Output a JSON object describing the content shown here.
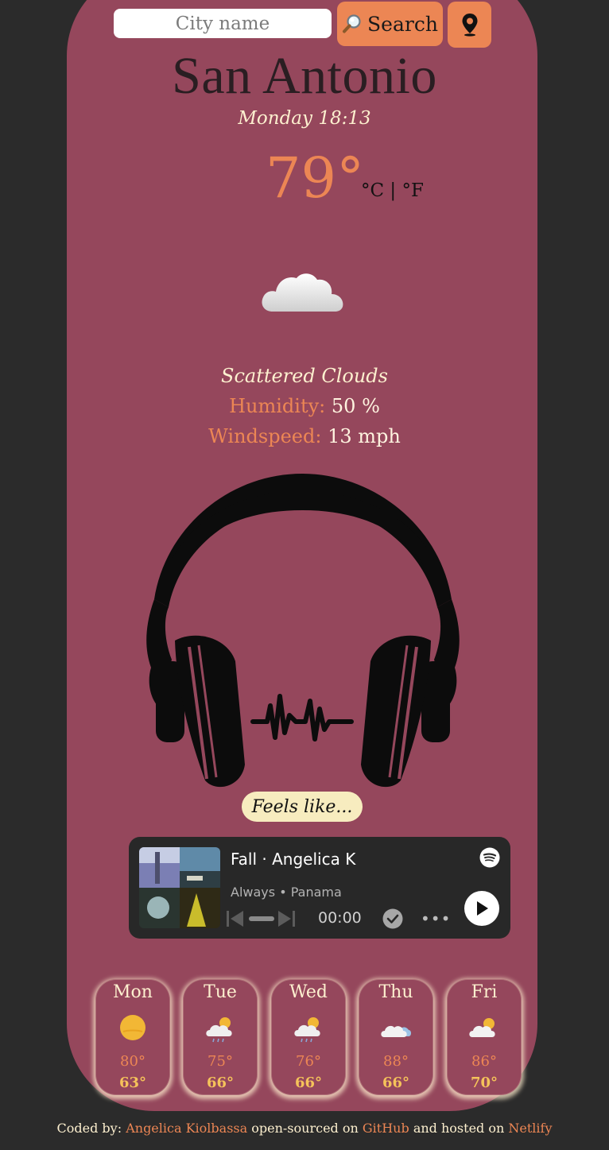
{
  "search": {
    "placeholder": "City name",
    "button_label": "Search",
    "button_icon": "magnifier-icon",
    "location_icon": "map-pin-icon"
  },
  "current": {
    "city": "San Antonio",
    "datetime": "Monday 18:13",
    "temperature": "79°",
    "units": "°C | °F",
    "icon": "cloud-icon",
    "description": "Scattered Clouds",
    "humidity_label": "Humidity:",
    "humidity_value": "50 %",
    "wind_label": "Windspeed:",
    "wind_value": "13 mph"
  },
  "mood": {
    "image": "headphones-soundwave-icon",
    "feels_label": "Feels like..."
  },
  "player": {
    "title": "Fall · Angelica K",
    "artist": "Always",
    "album": "Panama",
    "time": "00:00",
    "more": "•••",
    "brand_icon": "spotify-icon"
  },
  "forecast": [
    {
      "day": "Mon",
      "high": "80°",
      "low": "63°",
      "icon": "sun-icon"
    },
    {
      "day": "Tue",
      "high": "75°",
      "low": "66°",
      "icon": "sun-cloud-rain-icon"
    },
    {
      "day": "Wed",
      "high": "76°",
      "low": "66°",
      "icon": "sun-cloud-rain-icon"
    },
    {
      "day": "Thu",
      "high": "88°",
      "low": "66°",
      "icon": "cloud-icon"
    },
    {
      "day": "Fri",
      "high": "86°",
      "low": "70°",
      "icon": "sun-cloud-icon"
    }
  ],
  "footer": {
    "prefix": "Coded by:",
    "author": "Angelica Kiolbassa",
    "middle": "open-sourced on",
    "repo": "GitHub",
    "middle2": "and hosted on",
    "host": "Netlify"
  },
  "colors": {
    "page_bg": "#2b2b2b",
    "card_bg": "#95475c",
    "accent": "#ec8654",
    "cream": "#fdf0cf"
  }
}
